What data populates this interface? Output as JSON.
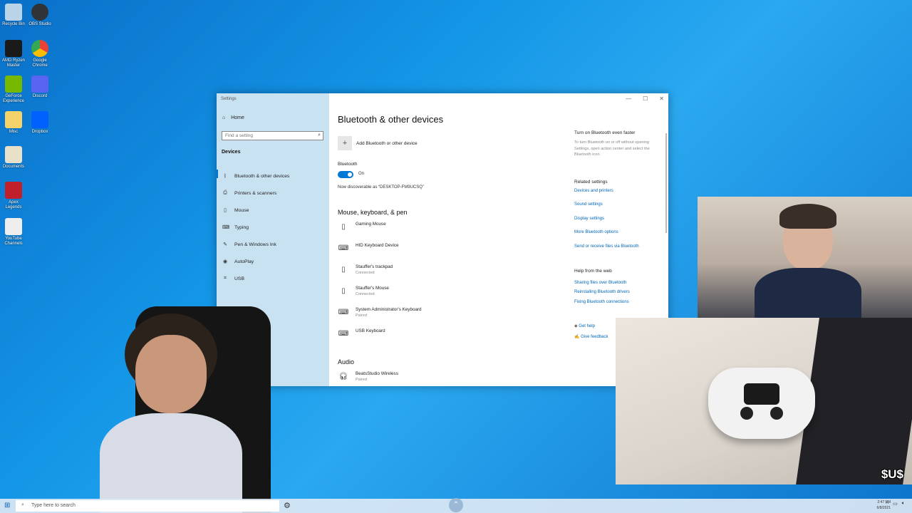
{
  "desktop": {
    "icons": [
      {
        "label": "Recycle Bin",
        "color": "#b9d4e8"
      },
      {
        "label": "OBS Studio",
        "color": "#303438"
      },
      {
        "label": "AMD Ryzen Master",
        "color": "#1a1a1a"
      },
      {
        "label": "Google Chrome",
        "color": "#e94235"
      },
      {
        "label": "GeForce Experience",
        "color": "#76b900"
      },
      {
        "label": "Discord",
        "color": "#5865f2"
      },
      {
        "label": "Misc",
        "color": "#f4d36a"
      },
      {
        "label": "Dropbox",
        "color": "#0061fe"
      },
      {
        "label": "Documents",
        "color": "#e8e0c8"
      },
      {
        "label": "Apex Legends",
        "color": "#c0202a"
      },
      {
        "label": "YouTube Channels",
        "color": "#eeeeee"
      }
    ]
  },
  "settings": {
    "window_title": "Settings",
    "sidebar": {
      "home": "Home",
      "search_placeholder": "Find a setting",
      "section": "Devices",
      "items": [
        {
          "label": "Bluetooth & other devices",
          "icon": "bluetooth-icon"
        },
        {
          "label": "Printers & scanners",
          "icon": "printer-icon"
        },
        {
          "label": "Mouse",
          "icon": "mouse-icon"
        },
        {
          "label": "Typing",
          "icon": "keyboard-icon"
        },
        {
          "label": "Pen & Windows Ink",
          "icon": "pen-icon"
        },
        {
          "label": "AutoPlay",
          "icon": "autoplay-icon"
        },
        {
          "label": "USB",
          "icon": "usb-icon"
        }
      ]
    },
    "main": {
      "title": "Bluetooth & other devices",
      "add_device": "Add Bluetooth or other device",
      "bluetooth_label": "Bluetooth",
      "toggle_state": "On",
      "discoverable": "Now discoverable as “DESKTOP-FM9UCSQ”",
      "mouse_section": "Mouse, keyboard, & pen",
      "devices": [
        {
          "name": "Gaming Mouse",
          "status": "",
          "icon": "mouse-icon"
        },
        {
          "name": "HID Keyboard Device",
          "status": "",
          "icon": "keyboard-icon"
        },
        {
          "name": "Stauffer's trackpad",
          "status": "Connected",
          "icon": "mouse-icon"
        },
        {
          "name": "Stauffer's Mouse",
          "status": "Connected",
          "icon": "mouse-icon"
        },
        {
          "name": "System Administrator's Keyboard",
          "status": "Paired",
          "icon": "keyboard-icon"
        },
        {
          "name": "USB Keyboard",
          "status": "",
          "icon": "keyboard-icon"
        }
      ],
      "audio_section": "Audio",
      "audio_devices": [
        {
          "name": "BeatsStudio Wireless",
          "status": "Paired",
          "icon": "headphones-icon"
        }
      ]
    },
    "right": {
      "faster_head": "Turn on Bluetooth even faster",
      "faster_text": "To turn Bluetooth on or off without opening Settings, open action center and select the Bluetooth icon.",
      "related_head": "Related settings",
      "related_links": [
        "Devices and printers",
        "Sound settings",
        "Display settings",
        "More Bluetooth options",
        "Send or receive files via Bluetooth"
      ],
      "web_head": "Help from the web",
      "web_links": [
        "Sharing files over Bluetooth",
        "Reinstalling Bluetooth drivers",
        "Fixing Bluetooth connections"
      ],
      "get_help": "Get help",
      "give_feedback": "Give feedback"
    }
  },
  "taskbar": {
    "search_placeholder": "Type here to search",
    "time": "2:47 PM",
    "date": "6/8/2021"
  },
  "overlay_logo": "$U$"
}
